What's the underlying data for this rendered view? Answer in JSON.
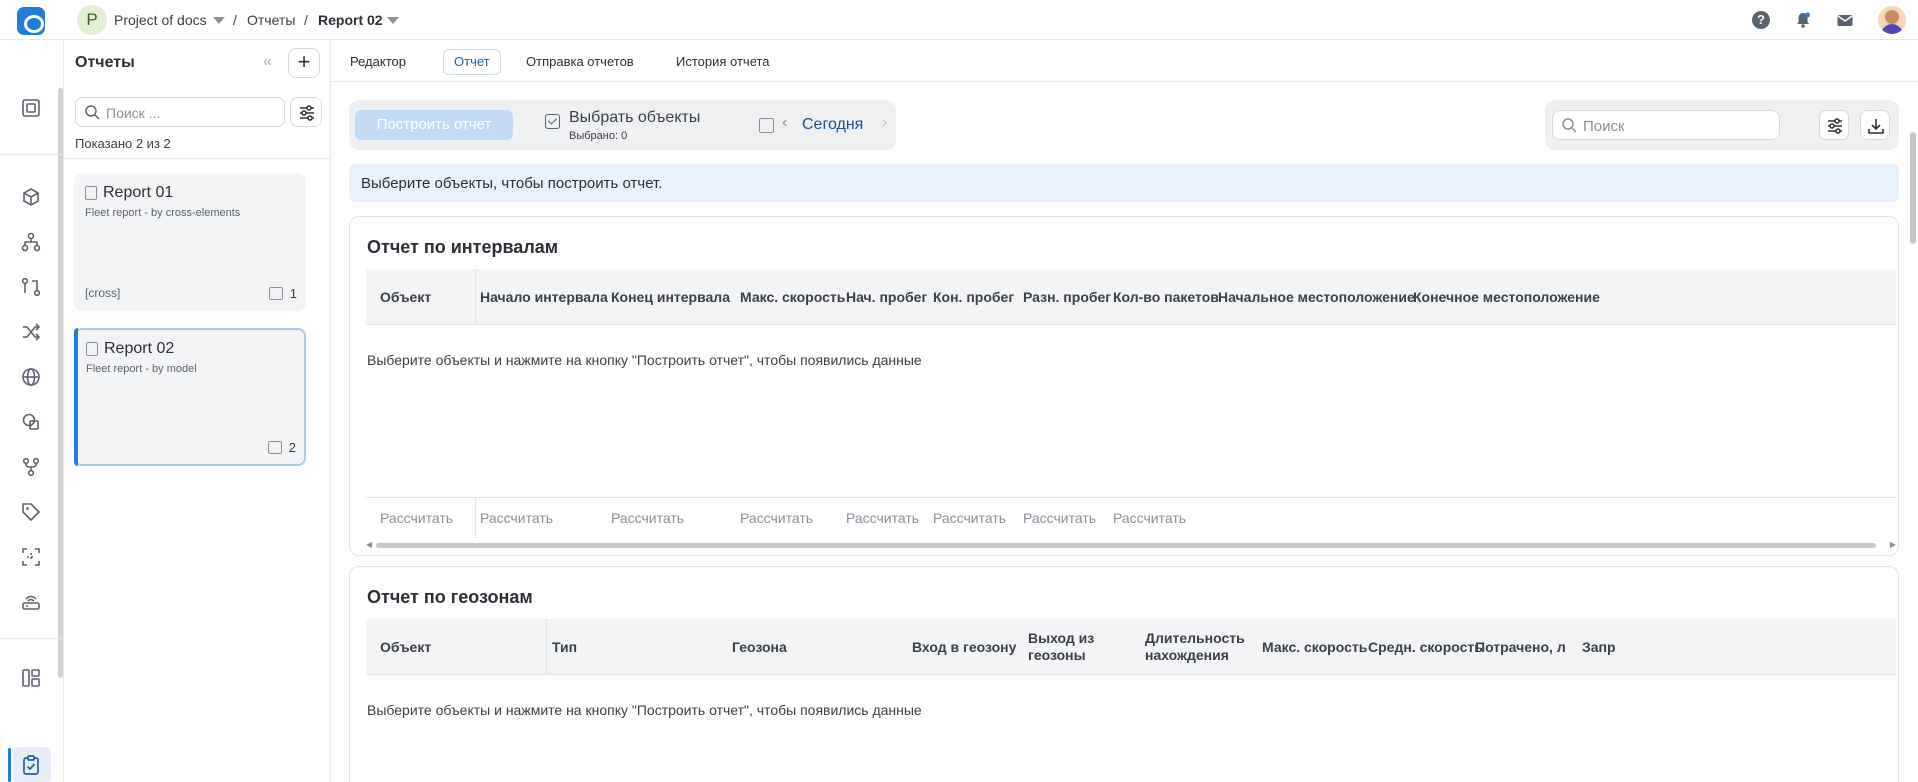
{
  "topbar": {
    "project_initial": "P",
    "project_name": "Project of docs",
    "breadcrumb_section": "Отчеты",
    "breadcrumb_current": "Report 02",
    "separator": "/",
    "help_glyph": "?"
  },
  "rail": {
    "icons": [
      "monitor-icon",
      "cube-icon",
      "hierarchy-icon",
      "git-compare-icon",
      "shuffle-icon",
      "globe-icon",
      "shapes-icon",
      "git-fork-icon",
      "tag-icon",
      "scan-icon",
      "router-icon",
      "layout-icon",
      "clipboard-check-icon",
      "clipboard-icon"
    ],
    "active": "clipboard-check-icon"
  },
  "list_panel": {
    "title": "Отчеты",
    "collapse_glyph": "«",
    "add_glyph": "+",
    "search_placeholder": "Поиск ...",
    "count_text": "Показано 2 из 2",
    "reports": [
      {
        "title": "Report 01",
        "subtitle": "Fleet report - by cross-elements",
        "tag": "[cross]",
        "count": "1",
        "selected": false
      },
      {
        "title": "Report 02",
        "subtitle": "Fleet report - by model",
        "tag": "",
        "count": "2",
        "selected": true
      }
    ]
  },
  "tabs": [
    {
      "label": "Редактор",
      "active": false
    },
    {
      "label": "Отчет",
      "active": true
    },
    {
      "label": "Отправка отчетов",
      "active": false
    },
    {
      "label": "История отчета",
      "active": false
    }
  ],
  "toolbar": {
    "build_label": "Построить отчет",
    "select_label": "Выбрать объекты",
    "selected_count": "Выбрано: 0",
    "date_label": "Сегодня",
    "prev_glyph": "‹",
    "next_glyph": "›"
  },
  "right_tools": {
    "search_placeholder": "Поиск"
  },
  "info_message": "Выберите объекты, чтобы построить отчет.",
  "intervals_report": {
    "title": "Отчет по интервалам",
    "columns": [
      "Объект",
      "Начало интервала",
      "Конец интервала",
      "Макс. скорость",
      "Нач. пробег",
      "Кон. пробег",
      "Разн. пробег",
      "Кол-во пакетов",
      "Начальное местоположение",
      "Конечное местоположение"
    ],
    "empty_message": "Выберите объекты и нажмите на кнопку \"Построить отчет\", чтобы появились данные",
    "footer": [
      "Рассчитать",
      "Рассчитать",
      "Рассчитать",
      "Рассчитать",
      "Рассчитать",
      "Рассчитать",
      "Рассчитать",
      "Рассчитать"
    ]
  },
  "geozones_report": {
    "title": "Отчет по геозонам",
    "columns": [
      "Объект",
      "Тип",
      "Геозона",
      "Вход в геозону",
      "Выход из геозоны",
      "Длительность нахождения",
      "Макс. скорость",
      "Средн. скорость",
      "Потрачено, л",
      "Запр"
    ],
    "empty_message": "Выберите объекты и нажмите на кнопку \"Построить отчет\", чтобы появились данные"
  },
  "colors": {
    "accent": "#1f7fd6",
    "build_button_disabled": "#c2daf5",
    "info_bg": "#e8f2fc",
    "date_link": "#1f4f8f",
    "active_tab_text": "#1f5fa8"
  }
}
